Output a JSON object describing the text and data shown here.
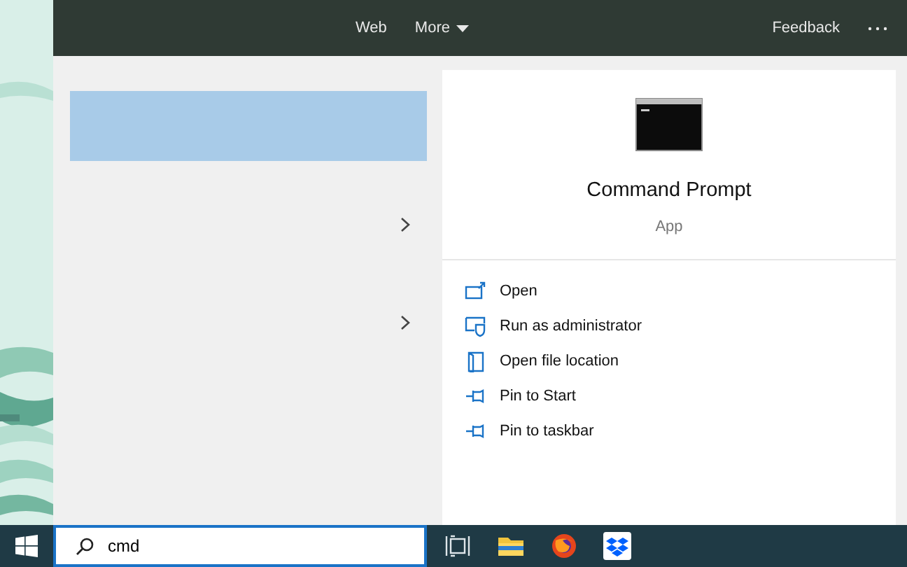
{
  "header": {
    "tabs": [
      {
        "label": "Web",
        "dropdown": false
      },
      {
        "label": "More",
        "dropdown": true
      }
    ],
    "feedback": "Feedback"
  },
  "results": [
    {
      "selected": true,
      "expandable": false
    },
    {
      "selected": false,
      "expandable": true
    },
    {
      "selected": false,
      "expandable": true
    }
  ],
  "app": {
    "name": "Command Prompt",
    "type": "App"
  },
  "actions": [
    {
      "kind": "open",
      "label": "Open"
    },
    {
      "kind": "admin",
      "label": "Run as administrator"
    },
    {
      "kind": "folder",
      "label": "Open file location"
    },
    {
      "kind": "pin",
      "label": "Pin to Start"
    },
    {
      "kind": "pin",
      "label": "Pin to taskbar"
    }
  ],
  "search": {
    "value": "cmd"
  }
}
